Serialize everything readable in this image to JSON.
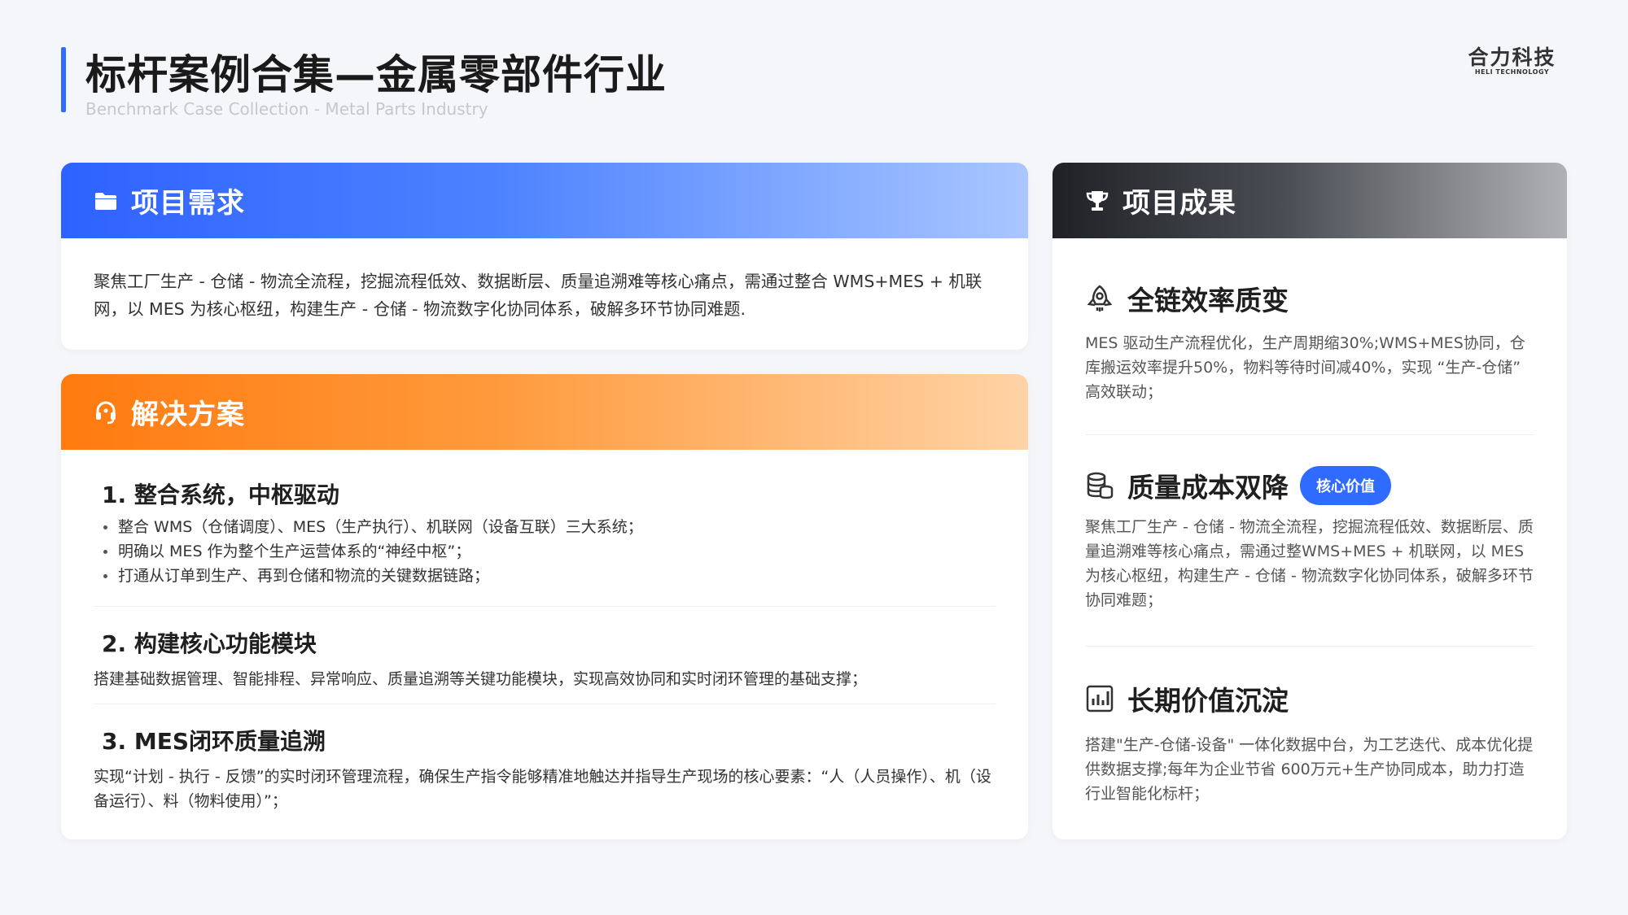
{
  "header": {
    "title": "标杆案例合集—金属零部件行业",
    "subtitle": "Benchmark Case Collection - Metal Parts Industry",
    "logo_main": "合力科技",
    "logo_sub": "HELI TECHNOLOGY"
  },
  "requirements": {
    "title": "项目需求",
    "icon": "folder-icon",
    "text": "聚焦工厂生产 - 仓储 - 物流全流程，挖掘流程低效、数据断层、质量追溯难等核心痛点，需通过整合 WMS+MES + 机联网，以 MES 为核心枢纽，构建生产 - 仓储 - 物流数字化协同体系，破解多环节协同难题."
  },
  "solution": {
    "title": "解决方案",
    "icon": "headset-icon",
    "sections": [
      {
        "heading": "1. 整合系统，中枢驱动",
        "bullets": [
          "整合 WMS（仓储调度）、MES（生产执行）、机联网（设备互联）三大系统；",
          "明确以 MES 作为整个生产运营体系的“神经中枢”；",
          "打通从订单到生产、再到仓储和物流的关键数据链路；"
        ]
      },
      {
        "heading": "2. 构建核心功能模块",
        "text": "搭建基础数据管理、智能排程、异常响应、质量追溯等关键功能模块，实现高效协同和实时闭环管理的基础支撑；"
      },
      {
        "heading": "3. MES闭环质量追溯",
        "text": "实现“计划 - 执行 - 反馈”的实时闭环管理流程，确保生产指令能够精准地触达并指导生产现场的核心要素：“人（人员操作）、机（设备运行）、料（物料使用）”；"
      }
    ]
  },
  "results": {
    "title": "项目成果",
    "icon": "trophy-icon",
    "items": [
      {
        "heading": "全链效率质变",
        "icon": "rocket-icon",
        "text": "MES 驱动生产流程优化，生产周期缩30%;WMS+MES协同，仓库搬运效率提升50%，物料等待时间减40%，实现 “生产-仓储” 高效联动；"
      },
      {
        "heading": "质量成本双降",
        "icon": "coins-icon",
        "badge": "核心价值",
        "text": "聚焦工厂生产 - 仓储 - 物流全流程，挖掘流程低效、数据断层、质量追溯难等核心痛点，需通过整WMS+MES + 机联网，以 MES 为核心枢纽，构建生产 - 仓储 - 物流数字化协同体系，破解多环节协同难题；"
      },
      {
        "heading": "长期价值沉淀",
        "icon": "bar-chart-icon",
        "text": "搭建\"生产-仓储-设备\" 一体化数据中台，为工艺迭代、成本优化提供数据支撑;每年为企业节省 600万元+生产协同成本，助力打造行业智能化标杆；"
      }
    ]
  }
}
